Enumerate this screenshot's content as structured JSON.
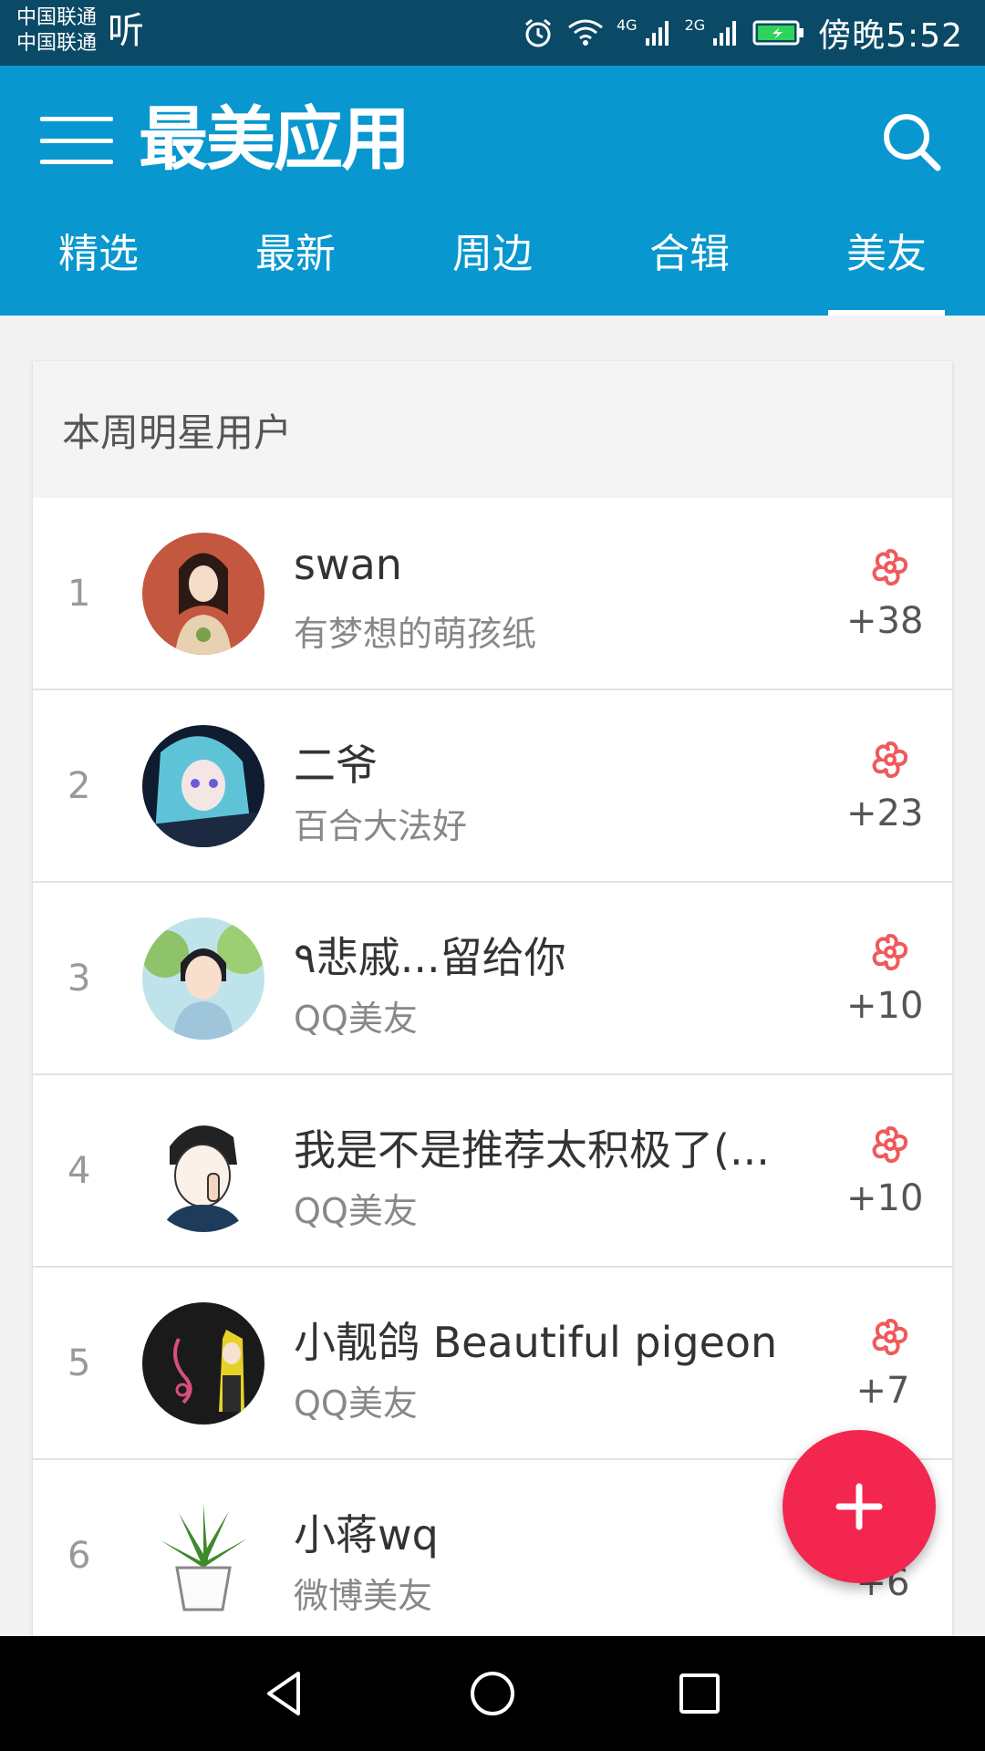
{
  "status_bar": {
    "carrier_1": "中国联通",
    "carrier_2": "中国联通",
    "carrier_extra": "听",
    "net_1": "4G",
    "net_2": "2G",
    "time": "傍晚5:52"
  },
  "app_bar": {
    "title": "最美应用",
    "tabs": [
      {
        "label": "精选"
      },
      {
        "label": "最新"
      },
      {
        "label": "周边"
      },
      {
        "label": "合辑"
      },
      {
        "label": "美友"
      }
    ],
    "active_tab": "美友"
  },
  "card": {
    "header": "本周明星用户",
    "users": [
      {
        "rank": "1",
        "name": "swan",
        "subtitle": "有梦想的萌孩纸",
        "score": "+38"
      },
      {
        "rank": "2",
        "name": "二爷",
        "subtitle": "百合大法好",
        "score": "+23"
      },
      {
        "rank": "3",
        "name": "٩悲戚...留给你",
        "subtitle": "QQ美友",
        "score": "+10"
      },
      {
        "rank": "4",
        "name": "我是不是推荐太积极了(...",
        "subtitle": "QQ美友",
        "score": "+10"
      },
      {
        "rank": "5",
        "name": "小靓鸽 Beautiful pigeon",
        "subtitle": "QQ美友",
        "score": "+7"
      },
      {
        "rank": "6",
        "name": "小蒋wq",
        "subtitle": "微博美友",
        "score": "+6"
      }
    ]
  },
  "colors": {
    "status_bar": "#0b4a66",
    "app_bar": "#0897cf",
    "fab": "#f2264f",
    "flower": "#f05a5a"
  },
  "icons": [
    "menu-icon",
    "search-icon",
    "flower-icon",
    "plus-icon",
    "back-icon",
    "home-icon",
    "recents-icon"
  ]
}
